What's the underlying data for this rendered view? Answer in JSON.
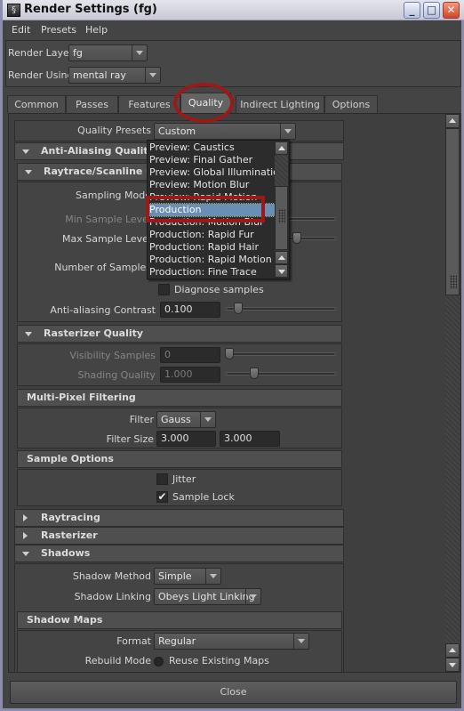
{
  "window": {
    "title": "Render Settings (fg)",
    "controls": {
      "minimize": "_",
      "maximize": "□",
      "close": "✕"
    }
  },
  "menu": [
    "Edit",
    "Presets",
    "Help"
  ],
  "render_layer": {
    "label": "Render Layer",
    "value": "fg"
  },
  "render_using": {
    "label": "Render Using",
    "value": "mental ray"
  },
  "tabs": [
    {
      "label": "Common",
      "active": false
    },
    {
      "label": "Passes",
      "active": false
    },
    {
      "label": "Features",
      "active": false
    },
    {
      "label": "Quality",
      "active": true
    },
    {
      "label": "Indirect Lighting",
      "active": false
    },
    {
      "label": "Options",
      "active": false
    }
  ],
  "quality_presets": {
    "label": "Quality Presets",
    "value": "Custom",
    "options_visible": [
      "Preview: Caustics",
      "Preview: Final Gather",
      "Preview: Global Illumination",
      "Preview: Motion Blur",
      "Preview: Rapid Motion",
      "Production",
      "Production: Motion Blur",
      "Production: Rapid Fur",
      "Production: Rapid Hair",
      "Production: Rapid Motion",
      "Production: Fine Trace"
    ],
    "highlighted": "Production"
  },
  "sections": {
    "anti_aliasing": "Anti-Aliasing Quality",
    "raytrace_scanline": "Raytrace/Scanline Quality",
    "rasterizer_quality": "Rasterizer Quality",
    "multi_pixel": "Multi-Pixel Filtering",
    "sample_options": "Sample Options",
    "raytracing": "Raytracing",
    "rasterizer": "Rasterizer",
    "shadows": "Shadows",
    "shadow_maps": "Shadow Maps"
  },
  "raytrace": {
    "sampling_mode_label": "Sampling Mode",
    "min_sample_label": "Min Sample Level",
    "max_sample_label": "Max Sample Level",
    "num_samples_label": "Number of Samples",
    "diagnose_label": "Diagnose samples",
    "diagnose_checked": false,
    "aa_contrast_label": "Anti-aliasing Contrast",
    "aa_contrast_value": "0.100"
  },
  "rasterizer_quality": {
    "visibility_label": "Visibility Samples",
    "visibility_value": "0",
    "shading_label": "Shading Quality",
    "shading_value": "1.000"
  },
  "filtering": {
    "filter_label": "Filter",
    "filter_value": "Gauss",
    "size_label": "Filter Size",
    "size_x": "3.000",
    "size_y": "3.000"
  },
  "sample_options": {
    "jitter_label": "Jitter",
    "jitter_checked": false,
    "lock_label": "Sample Lock",
    "lock_checked": true,
    "check_glyph": "✔"
  },
  "shadows": {
    "method_label": "Shadow Method",
    "method_value": "Simple",
    "linking_label": "Shadow Linking",
    "linking_value": "Obeys Light Linking"
  },
  "shadow_maps": {
    "format_label": "Format",
    "format_value": "Regular",
    "rebuild_label": "Rebuild Mode",
    "rebuild_value": "Reuse Existing Maps"
  },
  "footer": {
    "close_label": "Close"
  },
  "colors": {
    "annotation_red": "#9a1a1a",
    "selection_blue": "#6a8fb5"
  }
}
